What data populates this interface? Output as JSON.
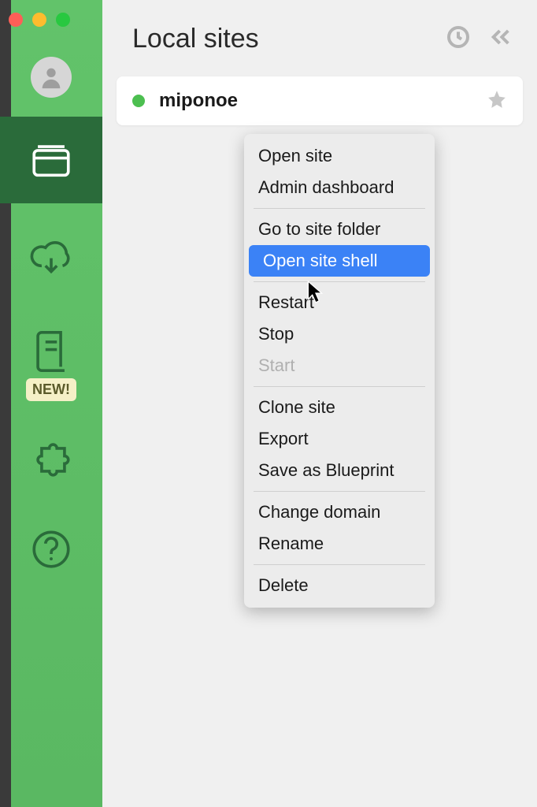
{
  "window": {
    "traffic_lights": [
      "close",
      "minimize",
      "zoom"
    ]
  },
  "sidebar": {
    "new_badge": "NEW!"
  },
  "header": {
    "title": "Local sites"
  },
  "site": {
    "name": "miponoe"
  },
  "context_menu": {
    "items": [
      {
        "label": "Open site",
        "type": "item"
      },
      {
        "label": "Admin dashboard",
        "type": "item"
      },
      {
        "label": "",
        "type": "sep"
      },
      {
        "label": "Go to site folder",
        "type": "item"
      },
      {
        "label": "Open site shell",
        "type": "item",
        "highlight": true
      },
      {
        "label": "",
        "type": "sep"
      },
      {
        "label": "Restart",
        "type": "item"
      },
      {
        "label": "Stop",
        "type": "item"
      },
      {
        "label": "Start",
        "type": "item",
        "disabled": true
      },
      {
        "label": "",
        "type": "sep"
      },
      {
        "label": "Clone site",
        "type": "item"
      },
      {
        "label": "Export",
        "type": "item"
      },
      {
        "label": "Save as Blueprint",
        "type": "item"
      },
      {
        "label": "",
        "type": "sep"
      },
      {
        "label": "Change domain",
        "type": "item"
      },
      {
        "label": "Rename",
        "type": "item"
      },
      {
        "label": "",
        "type": "sep"
      },
      {
        "label": "Delete",
        "type": "item"
      }
    ]
  }
}
